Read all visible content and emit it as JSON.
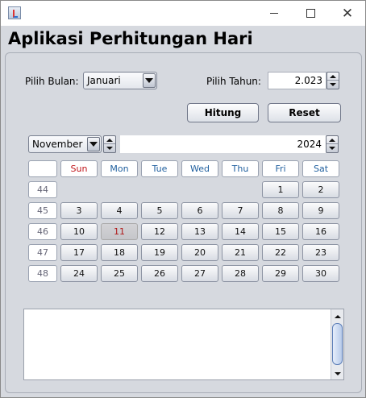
{
  "window": {
    "title": ""
  },
  "heading": "Aplikasi Perhitungan Hari",
  "form": {
    "month_label": "Pilih Bulan:",
    "month_value": "Januari",
    "year_label": "Pilih Tahun:",
    "year_value": "2.023",
    "hitung": "Hitung",
    "reset": "Reset"
  },
  "calendar": {
    "month": "November",
    "year": "2024",
    "weekday_headers": [
      "Sun",
      "Mon",
      "Tue",
      "Wed",
      "Thu",
      "Fri",
      "Sat"
    ],
    "today": "11",
    "weeks": [
      {
        "week": "44",
        "days": [
          "",
          "",
          "",
          "",
          "",
          "1",
          "2"
        ]
      },
      {
        "week": "45",
        "days": [
          "3",
          "4",
          "5",
          "6",
          "7",
          "8",
          "9"
        ]
      },
      {
        "week": "46",
        "days": [
          "10",
          "11",
          "12",
          "13",
          "14",
          "15",
          "16"
        ]
      },
      {
        "week": "47",
        "days": [
          "17",
          "18",
          "19",
          "20",
          "21",
          "22",
          "23"
        ]
      },
      {
        "week": "48",
        "days": [
          "24",
          "25",
          "26",
          "27",
          "28",
          "29",
          "30"
        ]
      }
    ]
  },
  "output": {
    "text": ""
  },
  "icons": {
    "app": "java-cup-icon",
    "minimize": "minimize-icon",
    "maximize": "maximize-icon",
    "close": "close-icon"
  }
}
